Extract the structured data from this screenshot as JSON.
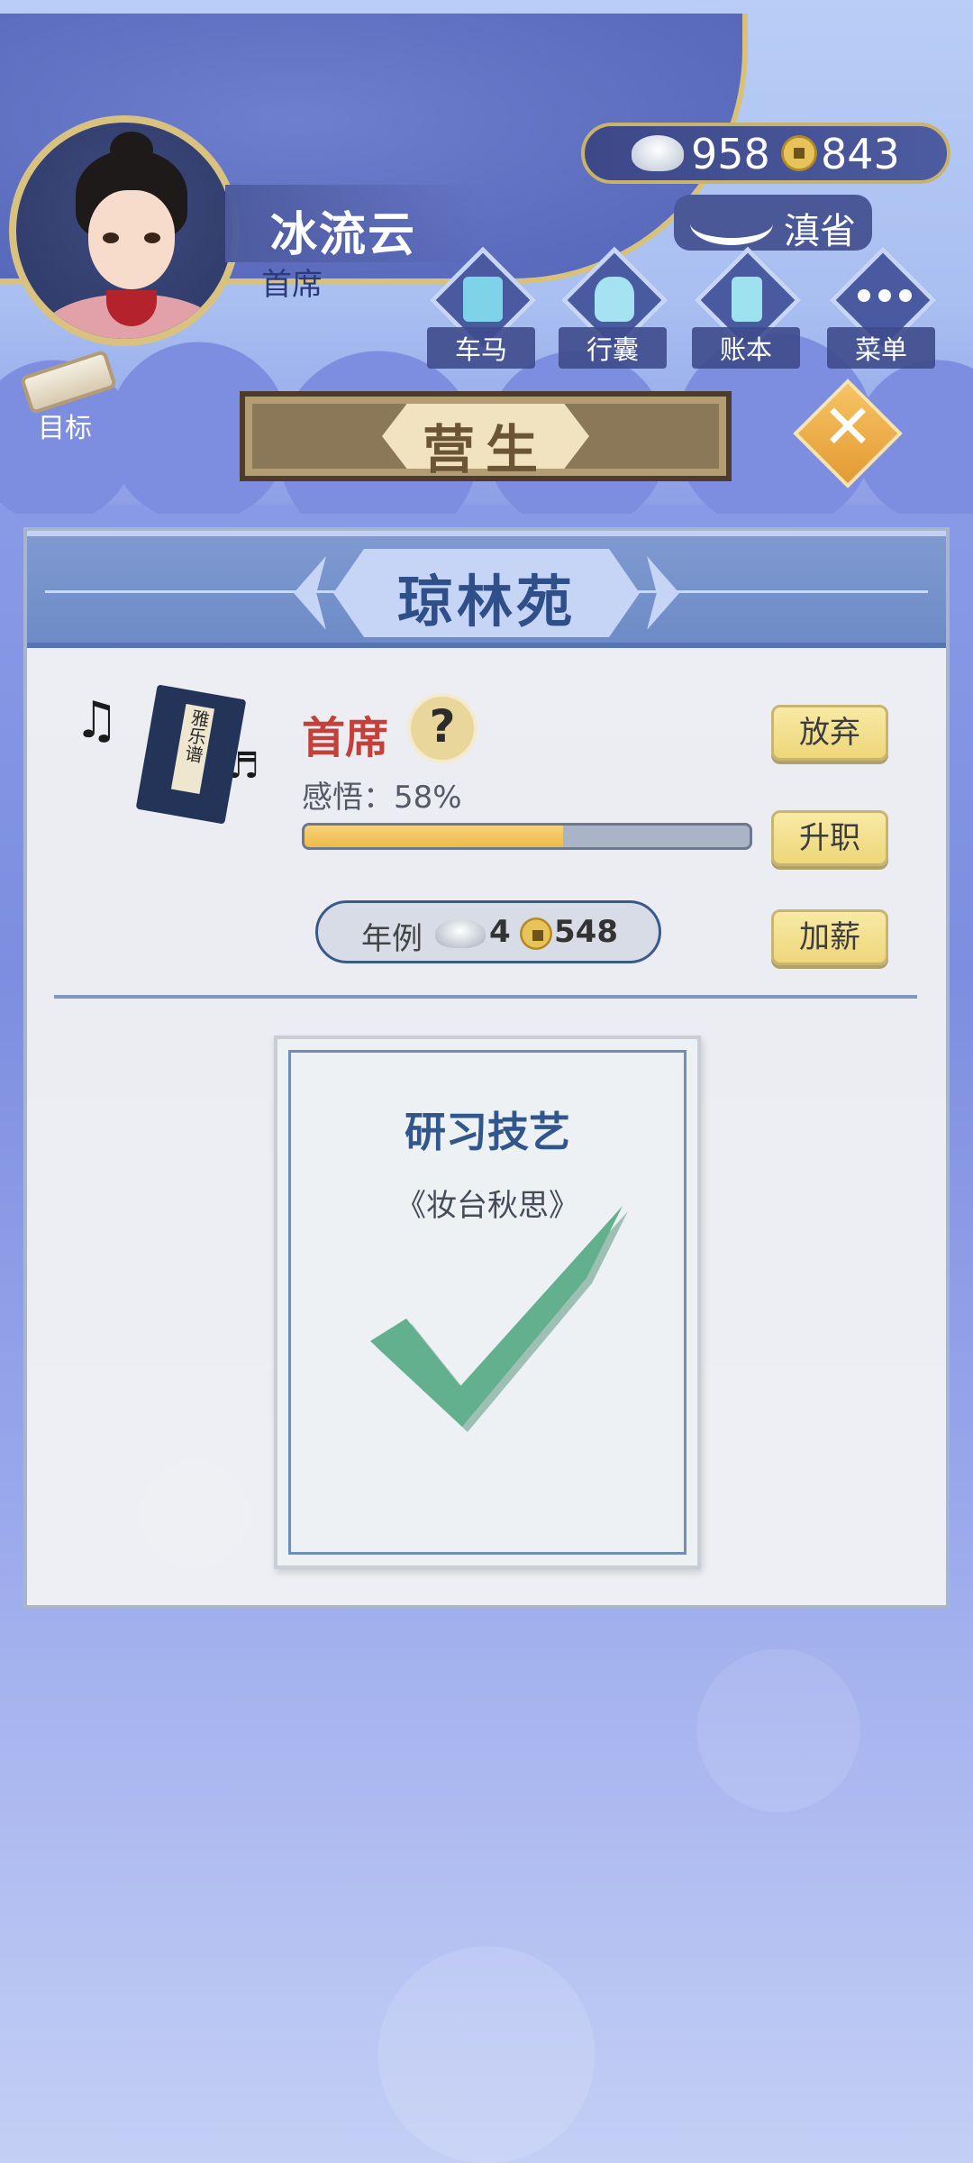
{
  "player": {
    "name": "冰流云",
    "rank": "首席"
  },
  "currency": {
    "silver": "958",
    "copper": "843"
  },
  "location": {
    "label": "滇省"
  },
  "nav": [
    {
      "label": "车马",
      "icon": "carriage-icon"
    },
    {
      "label": "行囊",
      "icon": "bag-icon"
    },
    {
      "label": "账本",
      "icon": "ledger-icon"
    },
    {
      "label": "菜单",
      "icon": "menu-dots-icon"
    }
  ],
  "goal": {
    "label": "目标"
  },
  "screen": {
    "title": "营生"
  },
  "panel": {
    "title": "琼林苑",
    "book_label": "雅乐谱",
    "job_rank": "首席",
    "help_glyph": "?",
    "insight": "感悟：58%",
    "insight_value": 0.58,
    "salary": {
      "label": "年例",
      "silver": "4",
      "copper": "548"
    },
    "buttons": {
      "quit": "放弃",
      "promote": "升职",
      "raise": "加薪"
    },
    "task": {
      "title": "研习技艺",
      "subtitle": "《妆台秋思》",
      "status": "completed"
    }
  },
  "colors": {
    "accent_gold": "#d9c27f",
    "rank_red": "#c2413a",
    "check_green": "#62b08e",
    "title_blue": "#2e4f8a"
  }
}
